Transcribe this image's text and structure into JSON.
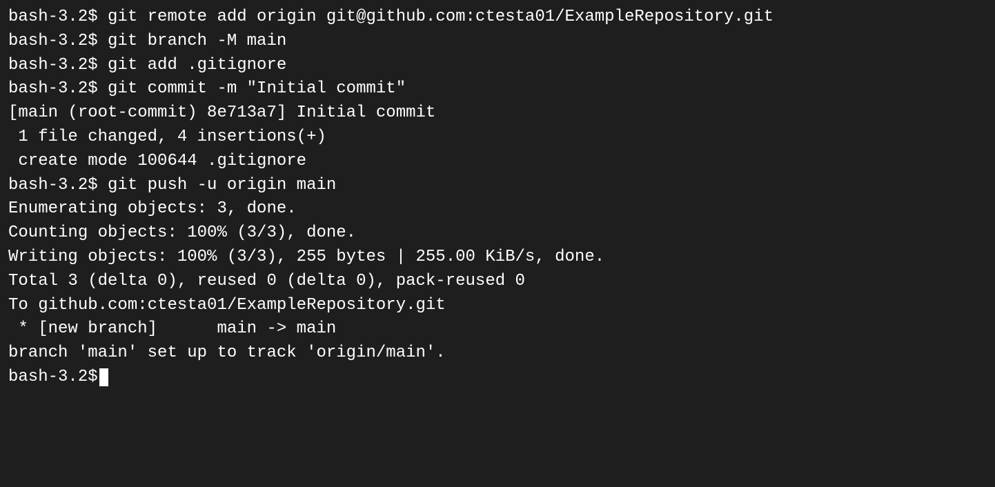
{
  "terminal": {
    "prompt": "bash-3.2$ ",
    "lines": [
      "bash-3.2$ git remote add origin git@github.com:ctesta01/ExampleRepository.git",
      "bash-3.2$ git branch -M main",
      "bash-3.2$ git add .gitignore",
      "bash-3.2$ git commit -m \"Initial commit\"",
      "[main (root-commit) 8e713a7] Initial commit",
      " 1 file changed, 4 insertions(+)",
      " create mode 100644 .gitignore",
      "bash-3.2$ git push -u origin main",
      "Enumerating objects: 3, done.",
      "Counting objects: 100% (3/3), done.",
      "Writing objects: 100% (3/3), 255 bytes | 255.00 KiB/s, done.",
      "Total 3 (delta 0), reused 0 (delta 0), pack-reused 0",
      "To github.com:ctesta01/ExampleRepository.git",
      " * [new branch]      main -> main",
      "branch 'main' set up to track 'origin/main'.",
      "bash-3.2$ "
    ]
  }
}
